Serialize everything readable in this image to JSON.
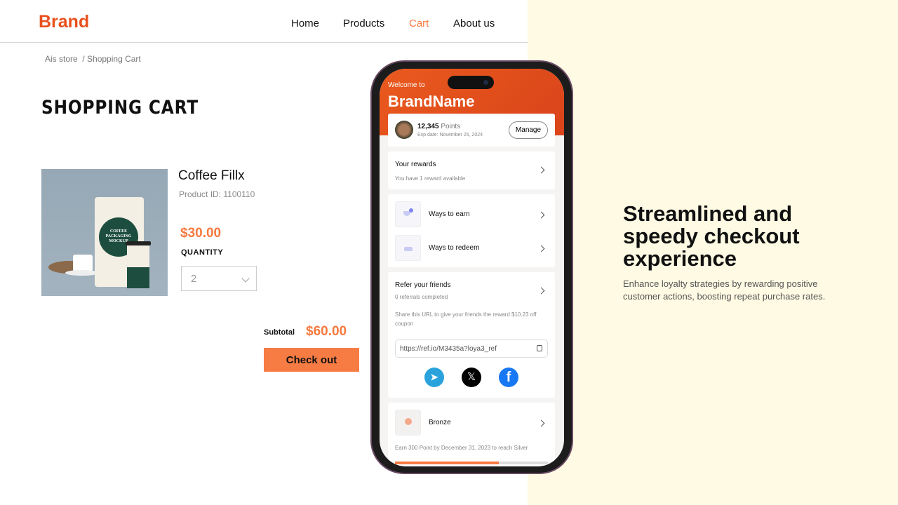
{
  "nav": {
    "brand": "Brand",
    "links": [
      "Home",
      "Products",
      "Cart",
      "About us"
    ],
    "active": "Cart",
    "accent": "#f7793e"
  },
  "breadcrumb": {
    "store": "Ais store",
    "current": "/ Shopping Cart"
  },
  "cart": {
    "title": "SHOPPING CART",
    "product": {
      "name": "Coffee Fillx",
      "id": "Product ID: 1100110",
      "price": "$30.00",
      "image_text": "COFFEE PACKAGING MOCKUP"
    },
    "quantity_label": "QUANTITY",
    "quantity": "2",
    "subtotal_label": "Subtotal",
    "subtotal": "$60.00",
    "checkout": "Check out"
  },
  "phone": {
    "welcome": "Welcome to",
    "brand_name": "BrandName",
    "points": "12,345",
    "points_label": "Points",
    "exp": "Exp date: November 25, 2024",
    "manage": "Manage",
    "rewards": {
      "title": "Your rewards",
      "sub": "You have 1 reward available"
    },
    "earn": "Ways to earn",
    "redeem": "Ways to redeem",
    "refer": {
      "title": "Refer your friends",
      "sub": "0 referrals completed",
      "desc": "Share this URL to give your friends the reward $10.23 off coupon",
      "url": "https://ref.io/M3435a?loya3_ref"
    },
    "social": [
      "telegram",
      "x",
      "facebook"
    ],
    "tier": {
      "name": "Bronze",
      "desc": "Earn 300 Point by December 31, 2023 to reach Silver",
      "progress": 0.68
    }
  },
  "promo": {
    "headline": "Streamlined and speedy checkout experience",
    "body": "Enhance loyalty strategies by rewarding positive customer actions, boosting repeat purchase rates."
  }
}
